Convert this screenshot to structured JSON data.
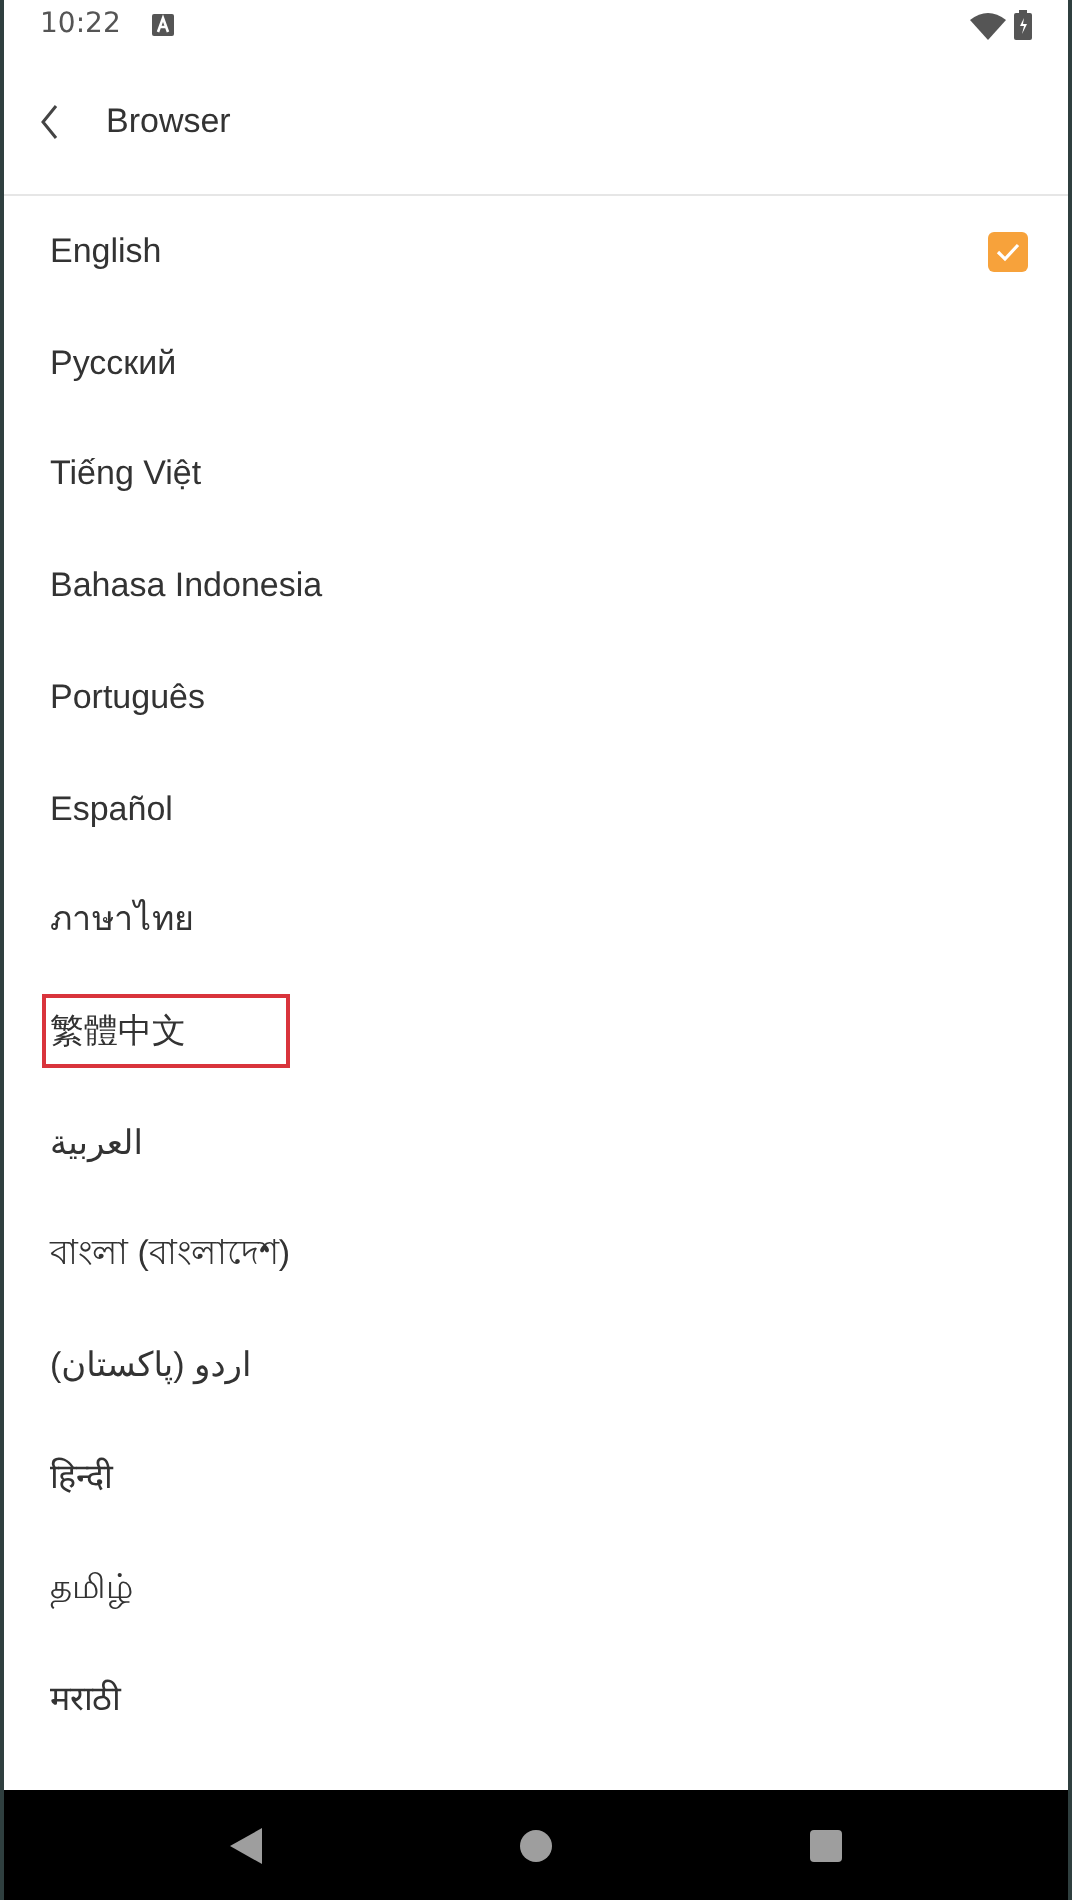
{
  "status_bar": {
    "time": "10:22"
  },
  "header": {
    "title": "Browser"
  },
  "languages": [
    {
      "label": "English",
      "selected": true,
      "highlighted": false
    },
    {
      "label": "Русский",
      "selected": false,
      "highlighted": false
    },
    {
      "label": "Tiếng Việt",
      "selected": false,
      "highlighted": false
    },
    {
      "label": "Bahasa Indonesia",
      "selected": false,
      "highlighted": false
    },
    {
      "label": "Português",
      "selected": false,
      "highlighted": false
    },
    {
      "label": "Español",
      "selected": false,
      "highlighted": false
    },
    {
      "label": "ภาษาไทย",
      "selected": false,
      "highlighted": false
    },
    {
      "label": "繁體中文",
      "selected": false,
      "highlighted": true
    },
    {
      "label": "العربية",
      "selected": false,
      "highlighted": false
    },
    {
      "label": "বাংলা (বাংলাদেশ)",
      "selected": false,
      "highlighted": false
    },
    {
      "label": "اردو (پاکستان)",
      "selected": false,
      "highlighted": false
    },
    {
      "label": "हिन्दी",
      "selected": false,
      "highlighted": false
    },
    {
      "label": "தமிழ்",
      "selected": false,
      "highlighted": false
    },
    {
      "label": "मराठी",
      "selected": false,
      "highlighted": false
    }
  ]
}
